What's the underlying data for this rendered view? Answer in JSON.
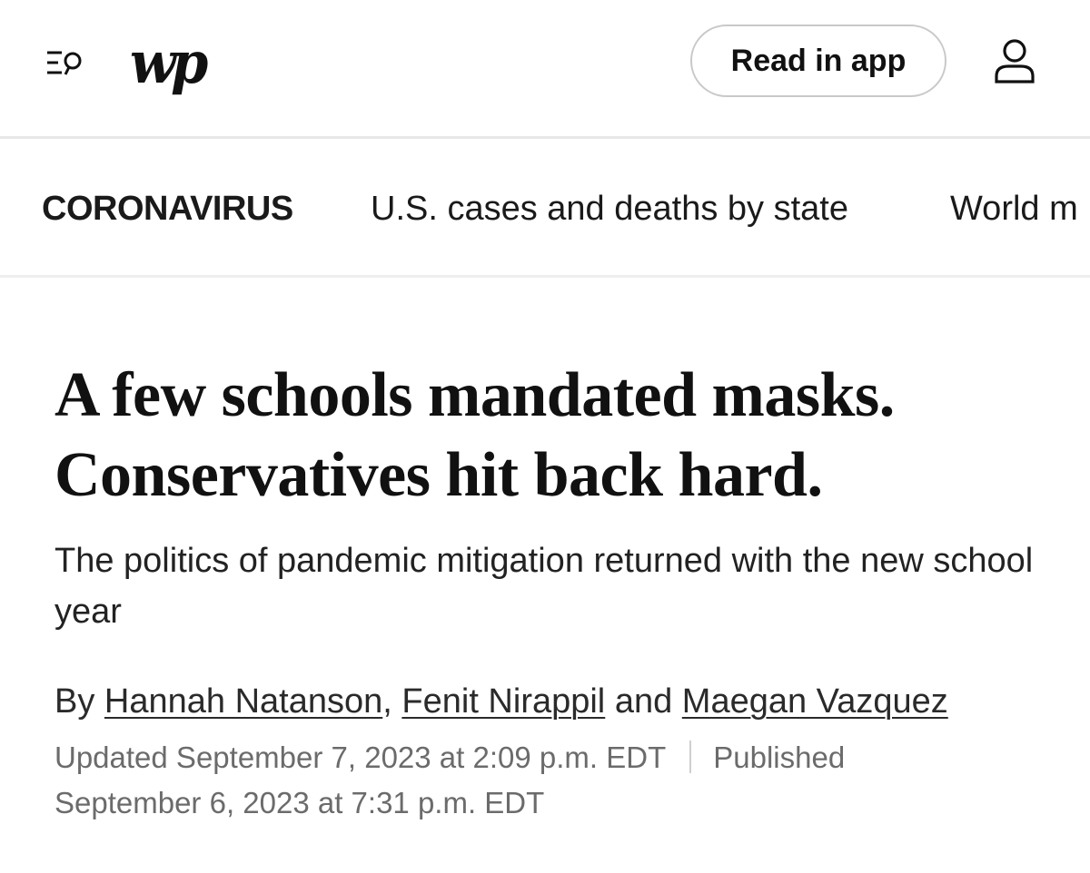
{
  "header": {
    "logo_text": "wp",
    "read_in_app_label": "Read in app",
    "menu_icon": "menu-search-icon",
    "account_icon": "account-icon"
  },
  "section_nav": {
    "section_label": "CORONAVIRUS",
    "links": [
      "U.S. cases and deaths by state",
      "World m"
    ]
  },
  "article": {
    "headline": "A few schools mandated masks. Conservatives hit back hard.",
    "subheadline": "The politics of pandemic mitigation returned with the new school year",
    "byline": {
      "prefix": "By",
      "authors": [
        "Hannah Natanson",
        "Fenit Nirappil",
        "Maegan Vazquez"
      ],
      "separator": ",",
      "conjunction": "and"
    },
    "updated": "Updated September 7, 2023 at 2:09 p.m. EDT",
    "published": "Published September 6, 2023 at 7:31 p.m. EDT"
  },
  "colors": {
    "text": "#111111",
    "meta_text": "#6b6b6b",
    "border": "#e8e8e8"
  }
}
